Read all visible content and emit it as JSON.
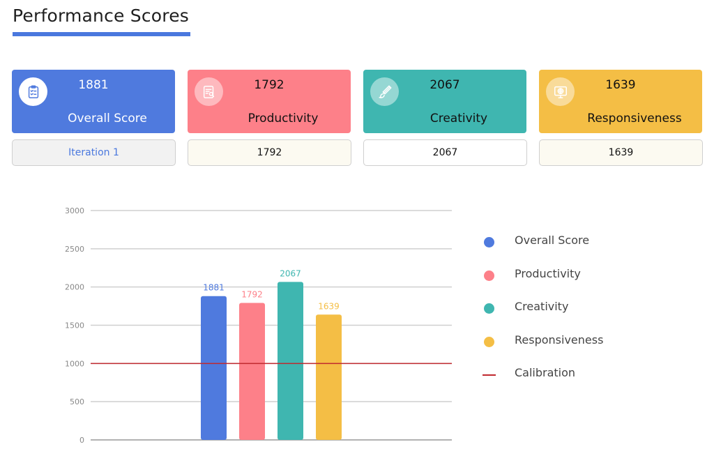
{
  "header": {
    "title": "Performance Scores"
  },
  "cards": [
    {
      "value": "1881",
      "label": "Overall Score",
      "icon": "clipboard-check-icon",
      "color": "#4f7ade"
    },
    {
      "value": "1792",
      "label": "Productivity",
      "icon": "document-search-icon",
      "color": "#fd8089"
    },
    {
      "value": "2067",
      "label": "Creativity",
      "icon": "paintbrush-icon",
      "color": "#3fb6b0"
    },
    {
      "value": "1639",
      "label": "Responsiveness",
      "icon": "monitor-globe-icon",
      "color": "#f4be45"
    }
  ],
  "subboxes": [
    "Iteration 1",
    "1792",
    "2067",
    "1639"
  ],
  "chart_data": {
    "type": "bar",
    "categories": [
      "Overall Score",
      "Productivity",
      "Creativity",
      "Responsiveness"
    ],
    "values": [
      1881,
      1792,
      2067,
      1639
    ],
    "colors": [
      "#4f7ade",
      "#fd8089",
      "#3fb6b0",
      "#f4be45"
    ],
    "yticks": [
      0,
      500,
      1000,
      1500,
      2000,
      2500,
      3000
    ],
    "ylim": [
      0,
      3000
    ],
    "reference_line": {
      "name": "Calibration",
      "value": 1000,
      "color": "#c0282e"
    },
    "legend": {
      "position": "right"
    },
    "grid": true
  }
}
